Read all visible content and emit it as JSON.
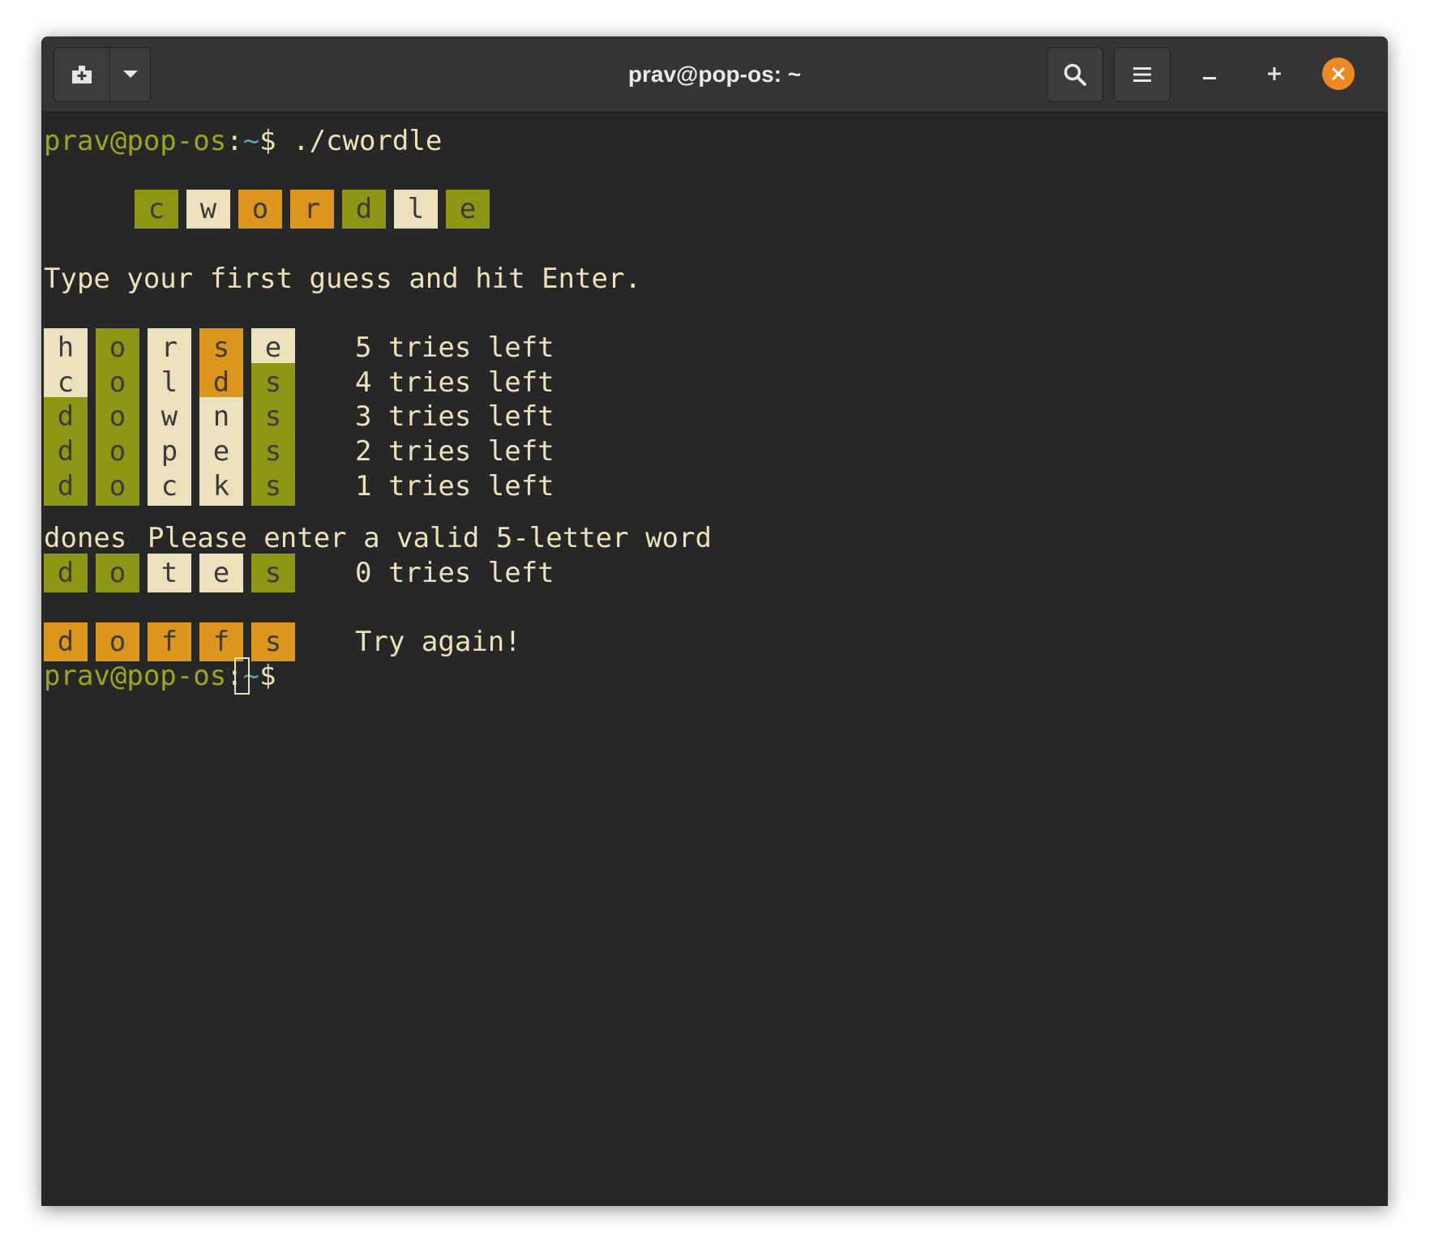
{
  "window": {
    "title": "prav@pop-os: ~"
  },
  "header": {
    "new_tab_icon": "new-tab-icon",
    "dropdown_icon": "chevron-down-icon",
    "search_icon": "search-icon",
    "menu_icon": "hamburger-menu-icon",
    "minimize_icon": "minimize-icon",
    "maximize_icon": "maximize-icon",
    "close_icon": "close-icon",
    "close_color": "#ef8a23"
  },
  "colors": {
    "background": "#272727",
    "text": "#ece0bd",
    "prompt_user": "#9ea51f",
    "prompt_path": "#5aa2b3",
    "tile_correct": "#8c9514",
    "tile_present": "#dc961e",
    "tile_absent": "#ede1bd"
  },
  "terminal": {
    "prompt": {
      "user_host": "prav@pop-os",
      "colon": ":",
      "path": "~",
      "symbol": "$"
    },
    "command": " ./cwordle",
    "logo_tiles": [
      {
        "letter": "c",
        "state": "correct"
      },
      {
        "letter": "w",
        "state": "absent"
      },
      {
        "letter": "o",
        "state": "present"
      },
      {
        "letter": "r",
        "state": "present"
      },
      {
        "letter": "d",
        "state": "correct"
      },
      {
        "letter": "l",
        "state": "absent"
      },
      {
        "letter": "e",
        "state": "correct"
      }
    ],
    "instructions": "Type your first guess and hit Enter.",
    "guesses": [
      {
        "tiles": [
          {
            "letter": "h",
            "state": "absent"
          },
          {
            "letter": "o",
            "state": "correct"
          },
          {
            "letter": "r",
            "state": "absent"
          },
          {
            "letter": "s",
            "state": "present"
          },
          {
            "letter": "e",
            "state": "absent"
          }
        ],
        "status": "5 tries left"
      },
      {
        "tiles": [
          {
            "letter": "c",
            "state": "absent"
          },
          {
            "letter": "o",
            "state": "correct"
          },
          {
            "letter": "l",
            "state": "absent"
          },
          {
            "letter": "d",
            "state": "present"
          },
          {
            "letter": "s",
            "state": "correct"
          }
        ],
        "status": "4 tries left"
      },
      {
        "tiles": [
          {
            "letter": "d",
            "state": "correct"
          },
          {
            "letter": "o",
            "state": "correct"
          },
          {
            "letter": "w",
            "state": "absent"
          },
          {
            "letter": "n",
            "state": "absent"
          },
          {
            "letter": "s",
            "state": "correct"
          }
        ],
        "status": "3 tries left"
      },
      {
        "tiles": [
          {
            "letter": "d",
            "state": "correct"
          },
          {
            "letter": "o",
            "state": "correct"
          },
          {
            "letter": "p",
            "state": "absent"
          },
          {
            "letter": "e",
            "state": "absent"
          },
          {
            "letter": "s",
            "state": "correct"
          }
        ],
        "status": "2 tries left"
      },
      {
        "tiles": [
          {
            "letter": "d",
            "state": "correct"
          },
          {
            "letter": "o",
            "state": "correct"
          },
          {
            "letter": "c",
            "state": "absent"
          },
          {
            "letter": "k",
            "state": "absent"
          },
          {
            "letter": "s",
            "state": "correct"
          }
        ],
        "status": "1 tries left"
      }
    ],
    "invalid_input": "dones",
    "invalid_message": "Please enter a valid 5-letter word",
    "last_guess": {
      "tiles": [
        {
          "letter": "d",
          "state": "correct"
        },
        {
          "letter": "o",
          "state": "correct"
        },
        {
          "letter": "t",
          "state": "absent"
        },
        {
          "letter": "e",
          "state": "absent"
        },
        {
          "letter": "s",
          "state": "correct"
        }
      ],
      "status": "0 tries left"
    },
    "answer": {
      "tiles": [
        {
          "letter": "d",
          "state": "present"
        },
        {
          "letter": "o",
          "state": "present"
        },
        {
          "letter": "f",
          "state": "present"
        },
        {
          "letter": "f",
          "state": "present"
        },
        {
          "letter": "s",
          "state": "present"
        }
      ],
      "message": "Try again!"
    }
  }
}
